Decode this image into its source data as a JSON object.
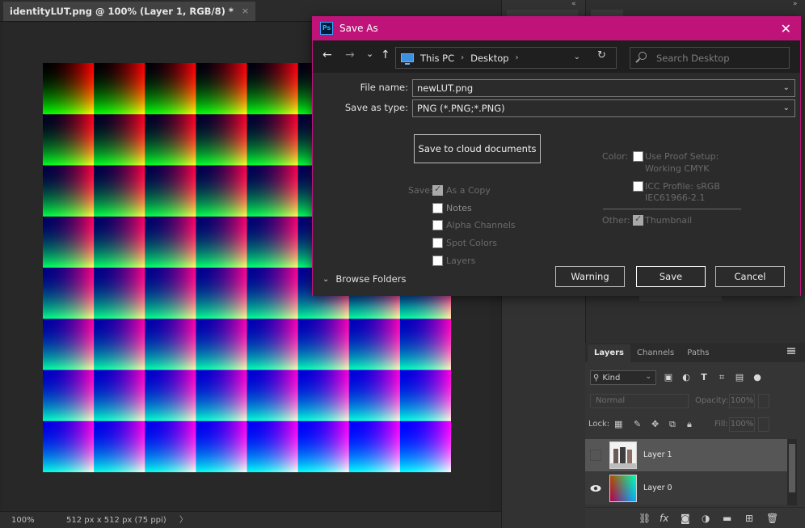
{
  "document": {
    "tab_title": "identityLUT.png @ 100% (Layer 1, RGB/8) *",
    "tab_close": "×",
    "status_zoom": "100%",
    "status_info": "512 px x 512 px (75 ppi)",
    "status_arrow": "〉"
  },
  "dialog": {
    "title": "Save As",
    "app_logo": "Ps",
    "close": "✕",
    "nav": {
      "back": "←",
      "forward": "→",
      "recent": "⌄",
      "up": "↑",
      "breadcrumbs": [
        "This PC",
        "Desktop"
      ],
      "breadcrumb_sep": "›",
      "address_chevron": "⌄",
      "refresh": "↻",
      "search_placeholder": "Search Desktop"
    },
    "filename_label": "File name:",
    "filename_value": "newLUT.png",
    "filetype_label": "Save as type:",
    "filetype_value": "PNG (*.PNG;*.PNG)",
    "cloud_button": "Save to cloud documents",
    "save_label": "Save:",
    "save_options": [
      {
        "label": "As a Copy",
        "checked": true
      },
      {
        "label": "Notes",
        "checked": false
      },
      {
        "label": "Alpha Channels",
        "checked": false
      },
      {
        "label": "Spot Colors",
        "checked": false
      },
      {
        "label": "Layers",
        "checked": false
      }
    ],
    "color_label": "Color:",
    "use_proof_label": "Use Proof Setup:",
    "use_proof_value": "Working CMYK",
    "icc_label": "ICC Profile:  sRGB",
    "icc_value": "IEC61966-2.1",
    "other_label": "Other:",
    "thumbnail_label": "Thumbnail",
    "browse_folders": "Browse Folders",
    "buttons": {
      "warning": "Warning",
      "save": "Save",
      "cancel": "Cancel"
    }
  },
  "layers_panel": {
    "tabs": [
      "Layers",
      "Channels",
      "Paths"
    ],
    "kind_label": "Kind",
    "blend_mode": "Normal",
    "opacity_label": "Opacity:",
    "opacity_value": "100%",
    "lock_label": "Lock:",
    "fill_label": "Fill:",
    "fill_value": "100%",
    "layers": [
      {
        "name": "Layer 1",
        "visible": false,
        "selected": true
      },
      {
        "name": "Layer 0",
        "visible": true,
        "selected": false
      }
    ]
  },
  "colors": {
    "dialog_accent": "#c0137a",
    "workspace": "#262626",
    "panel": "#353535"
  }
}
